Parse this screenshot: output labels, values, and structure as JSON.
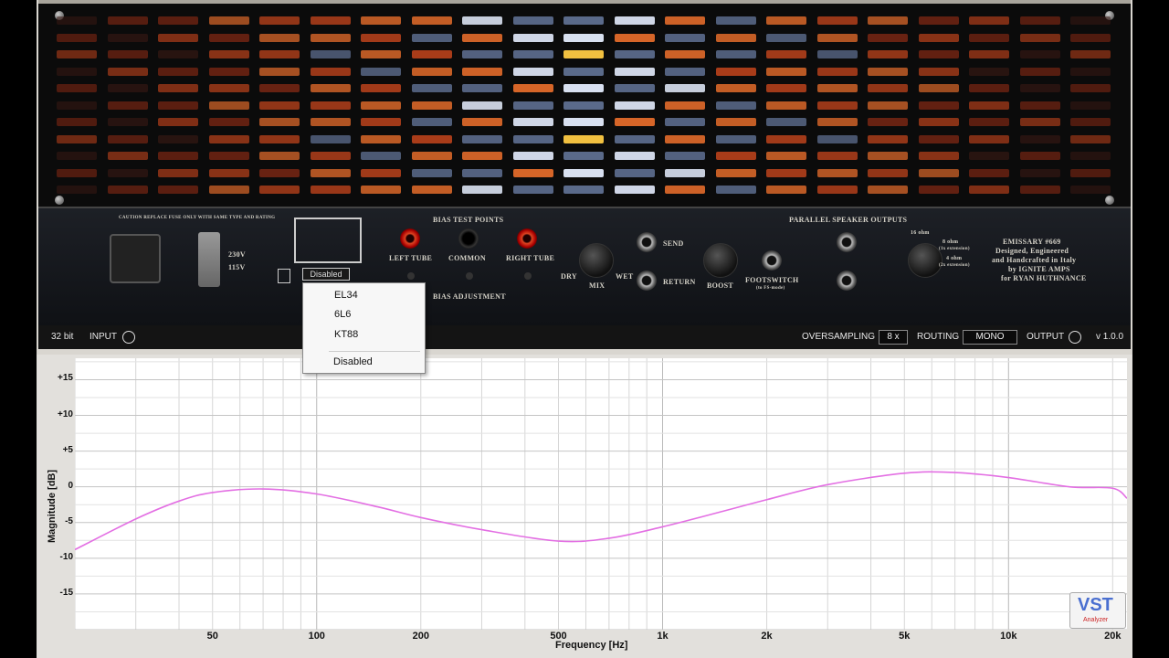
{
  "amp": {
    "caution_text": "CAUTION REPLACE FUSE ONLY WITH SAME TYPE AND RATING",
    "voltage_high": "230V",
    "voltage_low": "115V",
    "bias_test_points": "BIAS TEST POINTS",
    "left_tube": "LEFT TUBE",
    "common": "COMMON",
    "right_tube": "RIGHT TUBE",
    "bias_adjustment": "BIAS ADJUSTMENT",
    "dry": "DRY",
    "mix": "MIX",
    "wet": "WET",
    "send": "SEND",
    "return": "RETURN",
    "boost": "BOOST",
    "footswitch": "FOOTSWITCH",
    "footswitch_sub": "(to FS-mode)",
    "parallel_outputs": "PARALLEL SPEAKER OUTPUTS",
    "ohm_16": "16 ohm",
    "ohm_8": "8 ohm",
    "ohm_8_sub": "(1x extension)",
    "ohm_4": "4 ohm",
    "ohm_4_sub": "(2x extension)",
    "credits": [
      "EMISSARY #669",
      "Designed, Engineered",
      "and Handcrafted in Italy",
      "by IGNITE AMPS",
      "for RYAN HUTHNANCE"
    ]
  },
  "tube_selector": {
    "current": "Disabled",
    "options": [
      "EL34",
      "6L6",
      "KT88",
      "Disabled"
    ]
  },
  "statusbar": {
    "bit_depth": "32 bit",
    "input_label": "INPUT",
    "oversampling_label": "OVERSAMPLING",
    "oversampling_value": "8 x",
    "routing_label": "ROUTING",
    "routing_value": "MONO",
    "output_label": "OUTPUT",
    "version": "v 1.0.0"
  },
  "analyzer": {
    "badge_text": "VST",
    "badge_sub": "Analyzer"
  },
  "chart_data": {
    "type": "line",
    "xscale": "log",
    "xlabel": "Frequency [Hz]",
    "ylabel": "Magnitude [dB]",
    "xlim": [
      20,
      22000
    ],
    "ylim": [
      -20,
      18
    ],
    "xticks": [
      {
        "v": 50,
        "label": "50"
      },
      {
        "v": 100,
        "label": "100"
      },
      {
        "v": 200,
        "label": "200"
      },
      {
        "v": 500,
        "label": "500"
      },
      {
        "v": 1000,
        "label": "1k"
      },
      {
        "v": 2000,
        "label": "2k"
      },
      {
        "v": 5000,
        "label": "5k"
      },
      {
        "v": 10000,
        "label": "10k"
      },
      {
        "v": 20000,
        "label": "20k"
      }
    ],
    "yticks": [
      {
        "v": 15,
        "label": "+15"
      },
      {
        "v": 10,
        "label": "+10"
      },
      {
        "v": 5,
        "label": "+5"
      },
      {
        "v": 0,
        "label": "0"
      },
      {
        "v": -5,
        "label": "-5"
      },
      {
        "v": -10,
        "label": "-10"
      },
      {
        "v": -15,
        "label": "-15"
      }
    ],
    "grid": true,
    "series": [
      {
        "color": "#e36fe3",
        "x": [
          20,
          30,
          40,
          50,
          70,
          100,
          150,
          200,
          300,
          500,
          700,
          1000,
          1500,
          2000,
          3000,
          5000,
          7000,
          10000,
          15000,
          20000,
          22000
        ],
        "y": [
          -8.8,
          -4.5,
          -2.0,
          -0.8,
          -0.3,
          -1.0,
          -2.8,
          -4.3,
          -6.0,
          -7.6,
          -7.2,
          -5.6,
          -3.4,
          -1.8,
          0.3,
          1.9,
          2.0,
          1.3,
          0.0,
          -0.2,
          -1.6
        ]
      }
    ]
  }
}
